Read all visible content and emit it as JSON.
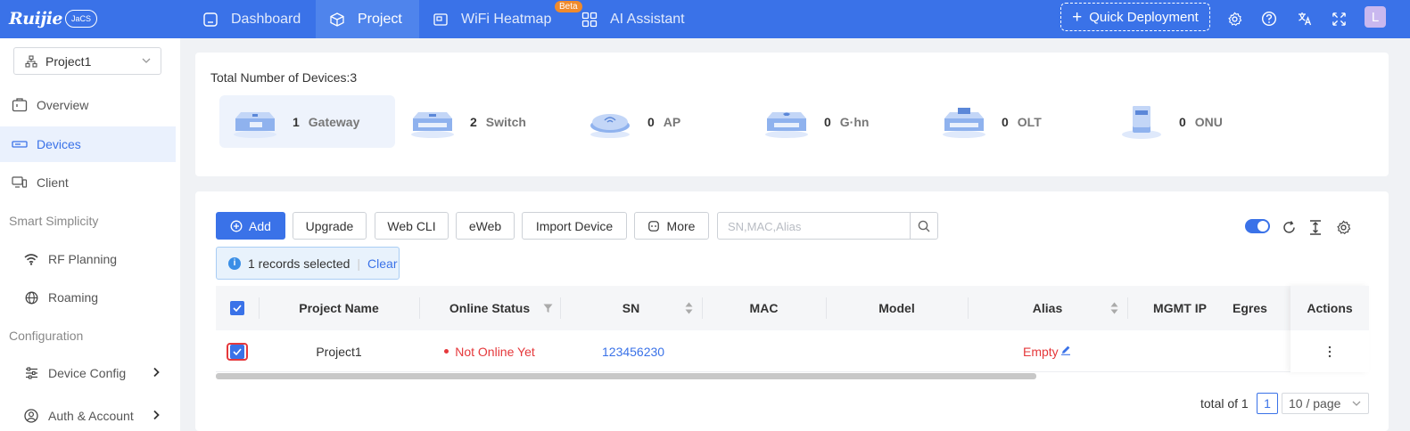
{
  "app": {
    "logo": "Ruijie",
    "logo_badge": "JaCS"
  },
  "nav": {
    "items": [
      {
        "label": "Dashboard",
        "icon": "dashboard-icon",
        "active": false
      },
      {
        "label": "Project",
        "icon": "cube-icon",
        "active": true
      },
      {
        "label": "WiFi Heatmap",
        "icon": "heatmap-icon",
        "active": false,
        "badge": "Beta"
      },
      {
        "label": "AI Assistant",
        "icon": "grid-icon",
        "active": false
      }
    ],
    "quick_deployment": "Quick Deployment",
    "avatar_letter": "L",
    "icons": [
      "gear-icon",
      "help-icon",
      "translate-icon",
      "fullscreen-icon"
    ]
  },
  "sidebar": {
    "project_selector": "Project1",
    "items": [
      {
        "label": "Overview",
        "icon": "overview-icon"
      },
      {
        "label": "Devices",
        "icon": "devices-icon",
        "active": true
      },
      {
        "label": "Client",
        "icon": "client-icon"
      }
    ],
    "group_smart": "Smart Simplicity",
    "smart_items": [
      {
        "label": "RF Planning",
        "icon": "wifi-icon"
      },
      {
        "label": "Roaming",
        "icon": "globe-icon"
      }
    ],
    "group_config": "Configuration",
    "config_items": [
      {
        "label": "Device Config",
        "icon": "sliders-icon"
      },
      {
        "label": "Auth & Account",
        "icon": "account-icon"
      }
    ]
  },
  "summary": {
    "total_label": "Total Number of Devices:3",
    "devices": [
      {
        "count": "1",
        "name": "Gateway",
        "selected": true
      },
      {
        "count": "2",
        "name": "Switch"
      },
      {
        "count": "0",
        "name": "AP"
      },
      {
        "count": "0",
        "name": "G·hn"
      },
      {
        "count": "0",
        "name": "OLT"
      },
      {
        "count": "0",
        "name": "ONU"
      }
    ]
  },
  "toolbar": {
    "add": "Add",
    "upgrade": "Upgrade",
    "web_cli": "Web CLI",
    "eweb": "eWeb",
    "import_device": "Import Device",
    "more": "More",
    "search_placeholder": "SN,MAC,Alias"
  },
  "selection": {
    "text": "1 records selected",
    "clear": "Clear"
  },
  "table": {
    "columns": [
      "Project Name",
      "Online Status",
      "SN",
      "MAC",
      "Model",
      "Alias",
      "MGMT IP",
      "Egres",
      "Actions"
    ],
    "rows": [
      {
        "project": "Project1",
        "status": "Not Online Yet",
        "sn": "123456230",
        "mac": "",
        "model": "",
        "alias": "Empty",
        "mgmt_ip": "",
        "egress": ""
      }
    ]
  },
  "pagination": {
    "total": "total of 1",
    "page": "1",
    "page_size": "10 / page"
  },
  "colors": {
    "primary": "#3a72e8",
    "danger": "#e5383b",
    "beta": "#f08a2c"
  }
}
